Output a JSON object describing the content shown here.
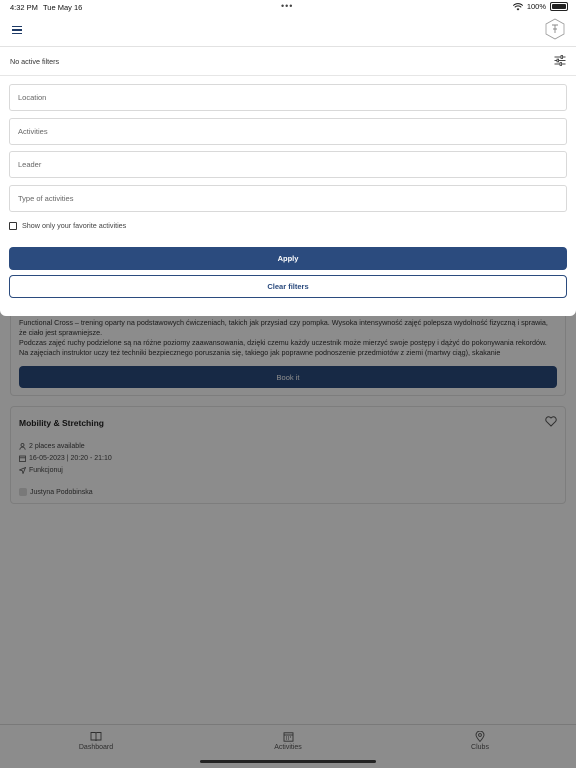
{
  "status": {
    "time": "4:32 PM",
    "date": "Tue May 16",
    "battery": "100%"
  },
  "filters": {
    "summary": "No active filters",
    "location_placeholder": "Location",
    "activities_placeholder": "Activities",
    "leader_placeholder": "Leader",
    "type_placeholder": "Type of activities",
    "favorites_label": "Show only your favorite activities",
    "apply_label": "Apply",
    "clear_label": "Clear filters"
  },
  "cards": [
    {
      "description_lines": [
        "Functional Cross – trening oparty na podstawowych ćwiczeniach, takich jak przysiad czy pompka. Wysoka intensywność zajęć polepsza wydolność fizyczną i sprawia,",
        "że ciało jest sprawniejsze.",
        "Podczas zajęć ruchy podzielone są na różne poziomy zaawansowania, dzięki czemu każdy uczestnik może mierzyć swoje postępy i dążyć do pokonywania rekordów.",
        "Na zajęciach instruktor uczy też techniki bezpiecznego poruszania się, takiego jak poprawne podnoszenie przedmiotów z ziemi (martwy ciąg), skakanie"
      ],
      "book_label": "Book it"
    },
    {
      "title": "Mobility & Stretching",
      "places": "2 places available",
      "datetime": "16-05-2023 | 20:20 - 21:10",
      "location": "Funkcjonuj",
      "leader": "Justyna Podobinska"
    }
  ],
  "nav": [
    {
      "label": "Dashboard",
      "icon": "book-icon"
    },
    {
      "label": "Activities",
      "icon": "calendar-icon"
    },
    {
      "label": "Clubs",
      "icon": "location-pin-icon"
    }
  ]
}
